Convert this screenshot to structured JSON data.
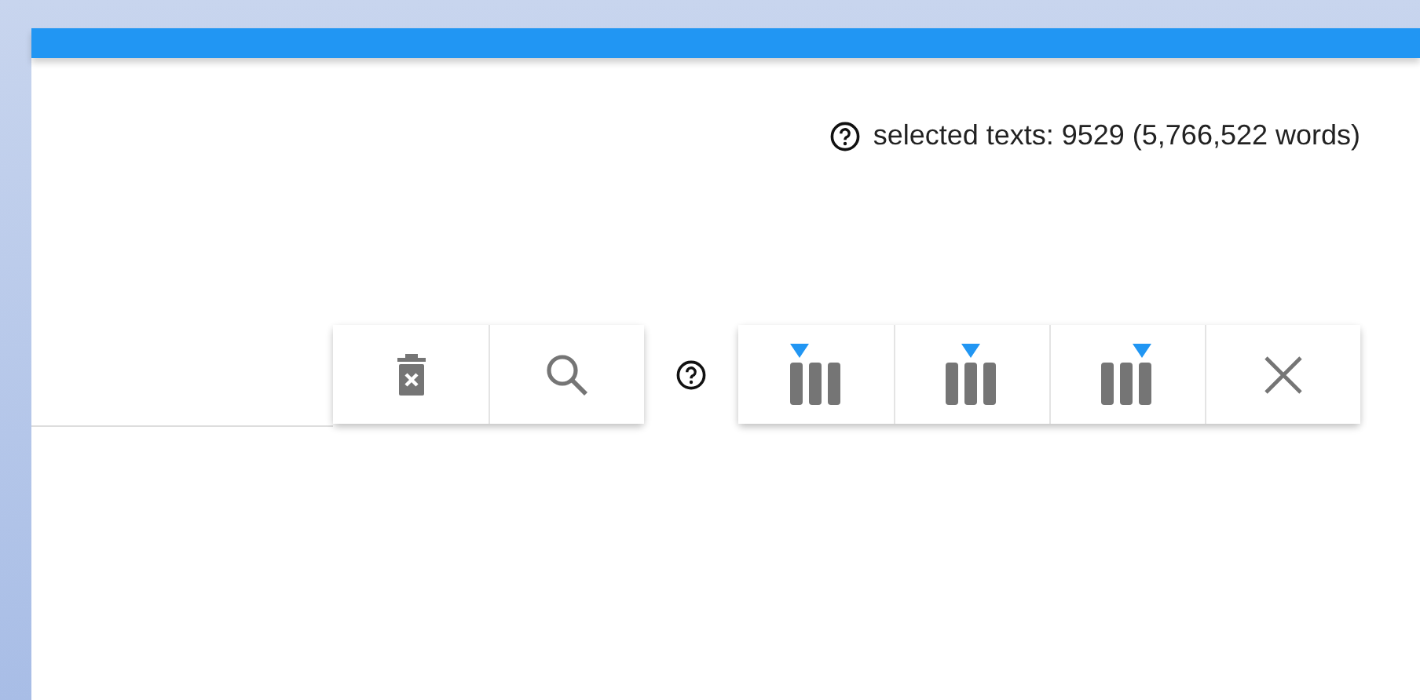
{
  "selection": {
    "text": "selected texts: 9529 (5,766,522 words)"
  },
  "left_tools": [
    {
      "kind": "delete"
    },
    {
      "kind": "search"
    }
  ],
  "column_tools": [
    {
      "kind": "column_left"
    },
    {
      "kind": "column_center"
    },
    {
      "kind": "column_right"
    },
    {
      "kind": "close"
    }
  ]
}
